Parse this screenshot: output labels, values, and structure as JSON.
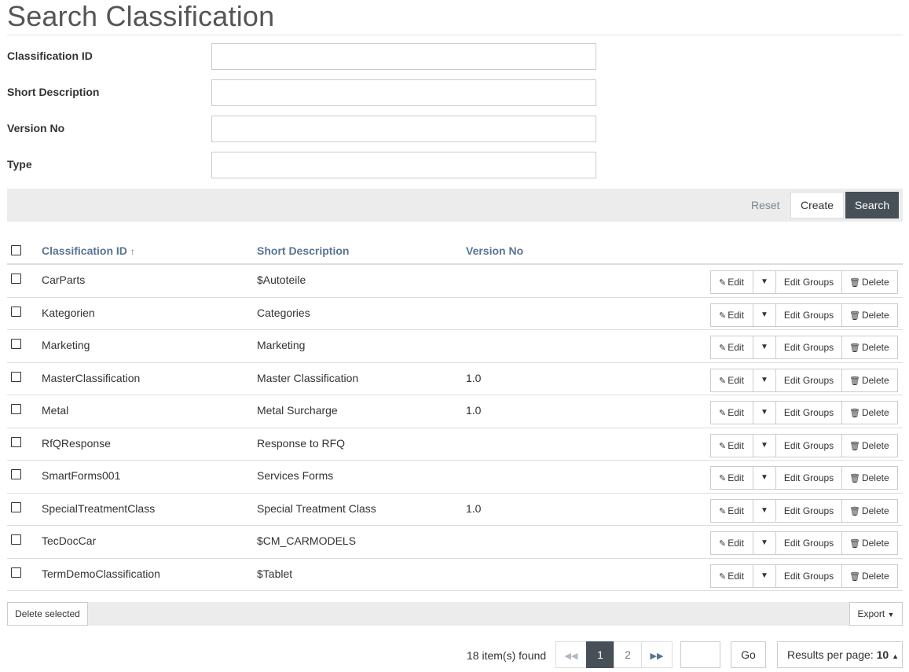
{
  "page": {
    "title": "Search Classification"
  },
  "form": {
    "fields": [
      {
        "label": "Classification ID",
        "value": "",
        "placeholder": ""
      },
      {
        "label": "Short Description",
        "value": "",
        "placeholder": ""
      },
      {
        "label": "Version No",
        "value": "",
        "placeholder": ""
      },
      {
        "label": "Type",
        "value": "",
        "placeholder": ""
      }
    ]
  },
  "toolbar": {
    "reset_label": "Reset",
    "create_label": "Create",
    "search_label": "Search"
  },
  "table": {
    "headers": {
      "id": "Classification ID",
      "sort_icon": "↑",
      "desc": "Short Description",
      "version": "Version No"
    },
    "row_actions": {
      "edit": "Edit",
      "edit_groups": "Edit Groups",
      "delete": "Delete"
    },
    "rows": [
      {
        "id": "CarParts",
        "desc": "$Autoteile",
        "version": ""
      },
      {
        "id": "Kategorien",
        "desc": "Categories",
        "version": ""
      },
      {
        "id": "Marketing",
        "desc": "Marketing",
        "version": ""
      },
      {
        "id": "MasterClassification",
        "desc": "Master Classification",
        "version": "1.0"
      },
      {
        "id": "Metal",
        "desc": "Metal Surcharge",
        "version": "1.0"
      },
      {
        "id": "RfQResponse",
        "desc": "Response to RFQ",
        "version": ""
      },
      {
        "id": "SmartForms001",
        "desc": "Services Forms",
        "version": ""
      },
      {
        "id": "SpecialTreatmentClass",
        "desc": "Special Treatment Class",
        "version": "1.0"
      },
      {
        "id": "TecDocCar",
        "desc": "$CM_CARMODELS",
        "version": ""
      },
      {
        "id": "TermDemoClassification",
        "desc": "$Tablet",
        "version": ""
      }
    ]
  },
  "footer": {
    "delete_selected_label": "Delete selected",
    "export_label": "Export"
  },
  "pagination": {
    "items_found": "18 item(s) found",
    "pages": [
      "1",
      "2"
    ],
    "current_page": "1",
    "go_label": "Go",
    "results_per_page_label": "Results per page:",
    "results_per_page_value": "10"
  },
  "colors": {
    "accent_dark": "#474f57",
    "header_link": "#5a7390",
    "toolbar_bg": "#ececec"
  }
}
